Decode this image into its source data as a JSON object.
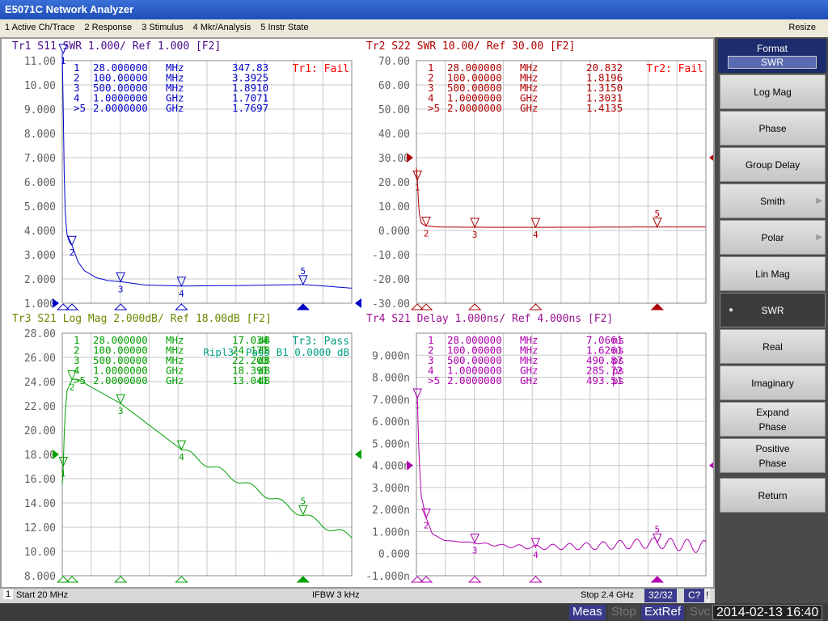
{
  "window": {
    "title": "E5071C Network Analyzer"
  },
  "menu": {
    "items": [
      "1 Active Ch/Trace",
      "2 Response",
      "3 Stimulus",
      "4 Mkr/Analysis",
      "5 Instr State"
    ],
    "resize": "Resize"
  },
  "traces": [
    {
      "id": "tr1",
      "header": "Tr1 S11 SWR 1.000/ Ref 1.000 [F2]",
      "color": "#0000c8",
      "header_color": "#4b0a8a",
      "limit": "Tr1: Fail",
      "limit_color": "#ff0000",
      "ymin": 1,
      "ymax": 11,
      "yticks": [
        "11.00",
        "10.00",
        "9.000",
        "8.000",
        "7.000",
        "6.000",
        "5.000",
        "4.000",
        "3.000",
        "2.000",
        "1.000"
      ],
      "ref": 1,
      "markers": [
        [
          "1",
          "28.000000",
          "MHz",
          "347.83",
          ""
        ],
        [
          "2",
          "100.00000",
          "MHz",
          "3.3925",
          ""
        ],
        [
          "3",
          "500.00000",
          "MHz",
          "1.8910",
          ""
        ],
        [
          "4",
          "1.0000000",
          "GHz",
          "1.7071",
          ""
        ],
        [
          ">5",
          "2.0000000",
          "GHz",
          "1.7697",
          ""
        ]
      ],
      "marker_values": [
        [
          28,
          347.83
        ],
        [
          100,
          3.3925
        ],
        [
          500,
          1.891
        ],
        [
          1000,
          1.7071
        ],
        [
          2000,
          1.7697
        ]
      ],
      "points": [
        [
          20,
          11.5
        ],
        [
          24,
          11
        ],
        [
          28,
          9
        ],
        [
          35,
          6.5
        ],
        [
          45,
          4.6
        ],
        [
          60,
          3.8
        ],
        [
          80,
          3.5
        ],
        [
          100,
          3.39
        ],
        [
          150,
          2.7
        ],
        [
          200,
          2.35
        ],
        [
          300,
          2.05
        ],
        [
          400,
          1.93
        ],
        [
          500,
          1.89
        ],
        [
          700,
          1.75
        ],
        [
          1000,
          1.71
        ],
        [
          1500,
          1.73
        ],
        [
          2000,
          1.77
        ],
        [
          2200,
          1.7
        ],
        [
          2400,
          1.62
        ]
      ]
    },
    {
      "id": "tr2",
      "header": "Tr2 S22 SWR 10.00/ Ref 30.00 [F2]",
      "color": "#b00000",
      "header_color": "#b00000",
      "limit": "Tr2: Fail",
      "limit_color": "#ff0000",
      "ymin": -30,
      "ymax": 70,
      "yticks": [
        "70.00",
        "60.00",
        "50.00",
        "40.00",
        "30.00",
        "20.00",
        "10.00",
        "0.000",
        "-10.00",
        "-20.00",
        "-30.00"
      ],
      "ref": 30,
      "markers": [
        [
          "1",
          "28.000000",
          "MHz",
          "20.832",
          ""
        ],
        [
          "2",
          "100.00000",
          "MHz",
          "1.8196",
          ""
        ],
        [
          "3",
          "500.00000",
          "MHz",
          "1.3150",
          ""
        ],
        [
          "4",
          "1.0000000",
          "GHz",
          "1.3031",
          ""
        ],
        [
          ">5",
          "2.0000000",
          "GHz",
          "1.4135",
          ""
        ]
      ],
      "marker_values": [
        [
          28,
          20.832
        ],
        [
          100,
          1.8196
        ],
        [
          500,
          1.315
        ],
        [
          1000,
          1.3031
        ],
        [
          2000,
          1.4135
        ]
      ],
      "points": [
        [
          20,
          26
        ],
        [
          28,
          20.8
        ],
        [
          40,
          8
        ],
        [
          60,
          3
        ],
        [
          100,
          1.82
        ],
        [
          200,
          1.4
        ],
        [
          500,
          1.32
        ],
        [
          1000,
          1.3
        ],
        [
          1500,
          1.35
        ],
        [
          2000,
          1.41
        ],
        [
          2400,
          1.4
        ]
      ]
    },
    {
      "id": "tr3",
      "header": "Tr3 S21 Log Mag 2.000dB/ Ref 18.00dB [F2]",
      "color": "#00a000",
      "header_color": "#6a8a00",
      "limit": "Tr3: Pass",
      "limit_color": "#00a080",
      "ripple": "Ripl3: Pass B1  0.0000  dB",
      "ymin": 8,
      "ymax": 28,
      "yticks": [
        "28.00",
        "26.00",
        "24.00",
        "22.00",
        "20.00",
        "18.00",
        "16.00",
        "14.00",
        "12.00",
        "10.00",
        "8.000"
      ],
      "ref": 18,
      "markers": [
        [
          "1",
          "28.000000",
          "MHz",
          "17.034",
          "dB"
        ],
        [
          "2",
          "100.00000",
          "MHz",
          "24.171",
          "dB"
        ],
        [
          "3",
          "500.00000",
          "MHz",
          "22.203",
          "dB"
        ],
        [
          "4",
          "1.0000000",
          "GHz",
          "18.391",
          "dB"
        ],
        [
          ">5",
          "2.0000000",
          "GHz",
          "13.041",
          "dB"
        ]
      ],
      "marker_values": [
        [
          28,
          17.034
        ],
        [
          100,
          24.171
        ],
        [
          500,
          22.203
        ],
        [
          1000,
          18.391
        ],
        [
          2000,
          13.041
        ]
      ],
      "points": [
        [
          20,
          15.5
        ],
        [
          28,
          17
        ],
        [
          40,
          21
        ],
        [
          60,
          23.3
        ],
        [
          100,
          24.17
        ],
        [
          150,
          24.2
        ],
        [
          250,
          23.6
        ],
        [
          500,
          22.2
        ],
        [
          750,
          20.3
        ],
        [
          1000,
          18.4
        ],
        [
          1250,
          17
        ],
        [
          1500,
          15.7
        ],
        [
          1750,
          14.4
        ],
        [
          2000,
          13.04
        ],
        [
          2200,
          12
        ],
        [
          2400,
          11.2
        ]
      ]
    },
    {
      "id": "tr4",
      "header": "Tr4 S21 Delay 1.000ns/ Ref 4.000ns [F2]",
      "color": "#b000b0",
      "header_color": "#9a1090",
      "limit": "",
      "ymin": -1,
      "ymax": 10,
      "yticks": [
        "",
        "9.000n",
        "8.000n",
        "7.000n",
        "6.000n",
        "5.000n",
        "4.000n",
        "3.000n",
        "2.000n",
        "1.000n",
        "0.000",
        "-1.000n"
      ],
      "ref": 4,
      "markers": [
        [
          "1",
          "28.000000",
          "MHz",
          "7.0661",
          "ns"
        ],
        [
          "2",
          "100.00000",
          "MHz",
          "1.6261",
          "ns"
        ],
        [
          "3",
          "500.00000",
          "MHz",
          "490.87",
          "ps"
        ],
        [
          "4",
          "1.0000000",
          "GHz",
          "285.72",
          "ps"
        ],
        [
          ">5",
          "2.0000000",
          "GHz",
          "493.51",
          "ps"
        ]
      ],
      "marker_values": [
        [
          28,
          7.0661
        ],
        [
          100,
          1.6261
        ],
        [
          500,
          0.49087
        ],
        [
          1000,
          0.28572
        ],
        [
          2000,
          0.49351
        ]
      ],
      "points": [
        [
          20,
          7.2
        ],
        [
          28,
          7.07
        ],
        [
          40,
          4.5
        ],
        [
          60,
          2.6
        ],
        [
          100,
          1.63
        ],
        [
          150,
          0.9
        ],
        [
          250,
          0.6
        ],
        [
          500,
          0.49
        ],
        [
          750,
          0.35
        ],
        [
          1000,
          0.29
        ],
        [
          1500,
          0.35
        ],
        [
          2000,
          0.49
        ],
        [
          2400,
          0.3
        ]
      ]
    }
  ],
  "stimulus": {
    "start_mhz": 20,
    "stop_mhz": 2400
  },
  "status": {
    "channel": "1",
    "start": "Start 20 MHz",
    "ifbw": "IFBW 3 kHz",
    "stop": "Stop 2.4 GHz",
    "points": "32/32",
    "cal": "C?",
    "warn": "!"
  },
  "softkeys": {
    "title": "Format",
    "current": "SWR",
    "items": [
      {
        "label": "Log Mag"
      },
      {
        "label": "Phase"
      },
      {
        "label": "Group Delay"
      },
      {
        "label": "Smith",
        "submenu": true
      },
      {
        "label": "Polar",
        "submenu": true
      },
      {
        "label": "Lin Mag"
      },
      {
        "label": "SWR",
        "selected": true
      },
      {
        "label": "Real"
      },
      {
        "label": "Imaginary"
      },
      {
        "label": "Expand Phase"
      },
      {
        "label": "Positive Phase"
      },
      {
        "label": "Return"
      }
    ]
  },
  "bottom": {
    "meas": "Meas",
    "stop": "Stop",
    "extref": "ExtRef",
    "svc": "Svc",
    "datetime": "2014-02-13 16:40"
  }
}
